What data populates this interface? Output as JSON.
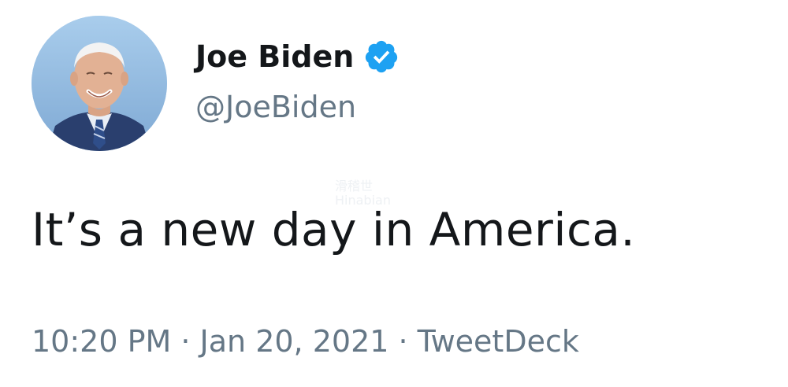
{
  "author": {
    "display_name": "Joe Biden",
    "handle": "@JoeBiden",
    "verified": true,
    "avatar_icon": "profile-photo"
  },
  "tweet": {
    "text": "It’s a new day in America."
  },
  "meta": {
    "time": "10:20 PM",
    "separator_1": " · ",
    "date": "Jan 20, 2021",
    "separator_2": " · ",
    "source": "TweetDeck"
  },
  "colors": {
    "verified_badge": "#1da1f2",
    "text_primary": "#14171a",
    "text_secondary": "#657786"
  },
  "watermark": {
    "line1": "滑稽世",
    "line2": "Hinabian"
  }
}
